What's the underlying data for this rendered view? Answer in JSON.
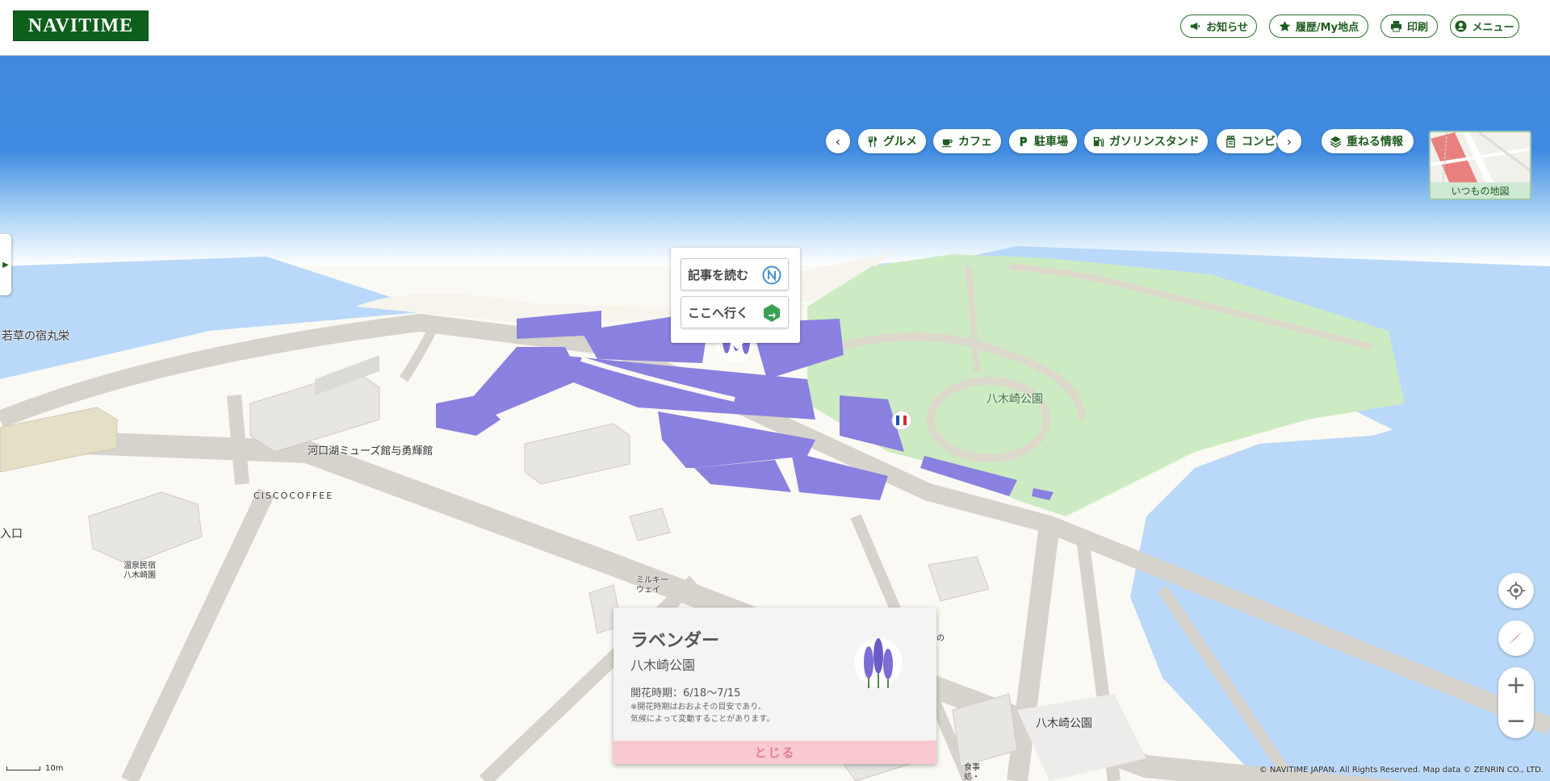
{
  "header": {
    "logo": "NAVITIME",
    "buttons": [
      {
        "label": "お知らせ",
        "icon": "megaphone-icon"
      },
      {
        "label": "履歴/My地点",
        "icon": "star-icon"
      },
      {
        "label": "印刷",
        "icon": "printer-icon"
      },
      {
        "label": "メニュー",
        "icon": "user-icon"
      }
    ]
  },
  "poi_bar": {
    "chips": [
      {
        "label": "グルメ",
        "icon": "fork-knife-icon"
      },
      {
        "label": "カフェ",
        "icon": "coffee-cup-icon"
      },
      {
        "label": "駐車場",
        "icon": "parking-icon"
      },
      {
        "label": "ガソリンスタンド",
        "icon": "gas-station-icon"
      },
      {
        "label": "コンビニ",
        "icon": "convenience-store-icon"
      }
    ],
    "overlay_label": "重ねる情報"
  },
  "map_switch": {
    "label": "いつもの地図"
  },
  "popup_menu": {
    "read_article": "記事を読む",
    "go_here": "ここへ行く"
  },
  "map_labels": {
    "wakakusa": "若草の宿丸栄",
    "museum": "河口湖ミューズ館与勇輝館",
    "cisco": "CISCOCOFFEE",
    "entrance": "入口",
    "minshuku": "温泉民宿\n八木崎園",
    "milky_way": "ミルキー\nウェイ",
    "park_top": "八木崎公園",
    "park_bottom": "八木崎公園",
    "restaurant": "食事\n処・\n温泉\n旅館\n秀水",
    "partial": "の"
  },
  "flower_card": {
    "name": "ラベンダー",
    "place": "八木崎公園",
    "period": "開花時期：6/18～7/15",
    "note_line1": "※開花時期はおおよその目安であり、",
    "note_line2": "気候によって変動することがあります。",
    "close": "とじる"
  },
  "scale": "10m",
  "copyright": "© NAVITIME JAPAN. All Rights Reserved. Map data © ZENRIN CO., LTD.",
  "colors": {
    "brand_green": "#0e5f1b",
    "lake_blue": "#b9d8fa",
    "sky_blue": "#3f8ae0",
    "park_green": "#cdebc2",
    "lavender": "#8a80e0",
    "close_pink": "#f8c9cf"
  }
}
